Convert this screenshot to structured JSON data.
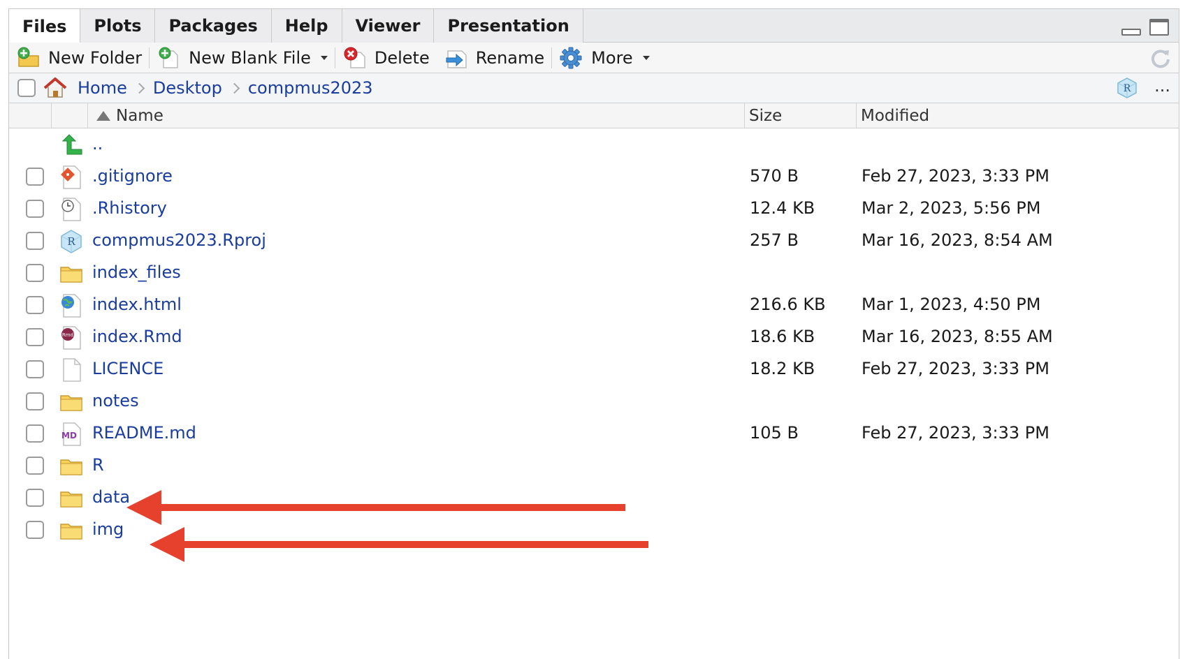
{
  "tabs": [
    {
      "label": "Files"
    },
    {
      "label": "Plots"
    },
    {
      "label": "Packages"
    },
    {
      "label": "Help"
    },
    {
      "label": "Viewer"
    },
    {
      "label": "Presentation"
    }
  ],
  "toolbar": {
    "new_folder": "New Folder",
    "new_blank_file": "New Blank File",
    "delete": "Delete",
    "rename": "Rename",
    "more": "More"
  },
  "path": {
    "crumbs": [
      "Home",
      "Desktop",
      "compmus2023"
    ],
    "more": "..."
  },
  "table": {
    "columns": {
      "name": "Name",
      "size": "Size",
      "modified": "Modified"
    },
    "parent": {
      "name": ".."
    },
    "rows": [
      {
        "name": ".gitignore",
        "size": "570 B",
        "modified": "Feb 27, 2023, 3:33 PM",
        "icon": "git-file-icon"
      },
      {
        "name": ".Rhistory",
        "size": "12.4 KB",
        "modified": "Mar 2, 2023, 5:56 PM",
        "icon": "history-file-icon"
      },
      {
        "name": "compmus2023.Rproj",
        "size": "257 B",
        "modified": "Mar 16, 2023, 8:54 AM",
        "icon": "rproj-icon"
      },
      {
        "name": "index_files",
        "size": "",
        "modified": "",
        "icon": "folder-icon"
      },
      {
        "name": "index.html",
        "size": "216.6 KB",
        "modified": "Mar 1, 2023, 4:50 PM",
        "icon": "html-file-icon"
      },
      {
        "name": "index.Rmd",
        "size": "18.6 KB",
        "modified": "Mar 16, 2023, 8:55 AM",
        "icon": "rmd-file-icon"
      },
      {
        "name": "LICENCE",
        "size": "18.2 KB",
        "modified": "Feb 27, 2023, 3:33 PM",
        "icon": "blank-file-icon"
      },
      {
        "name": "notes",
        "size": "",
        "modified": "",
        "icon": "folder-icon"
      },
      {
        "name": "README.md",
        "size": "105 B",
        "modified": "Feb 27, 2023, 3:33 PM",
        "icon": "markdown-file-icon"
      },
      {
        "name": "R",
        "size": "",
        "modified": "",
        "icon": "folder-icon"
      },
      {
        "name": "data",
        "size": "",
        "modified": "",
        "icon": "folder-icon"
      },
      {
        "name": "img",
        "size": "",
        "modified": "",
        "icon": "folder-icon"
      }
    ]
  },
  "colors": {
    "link": "#1a3d9e",
    "annotation_arrow": "#e5412d",
    "folder": "#f3c84f"
  }
}
